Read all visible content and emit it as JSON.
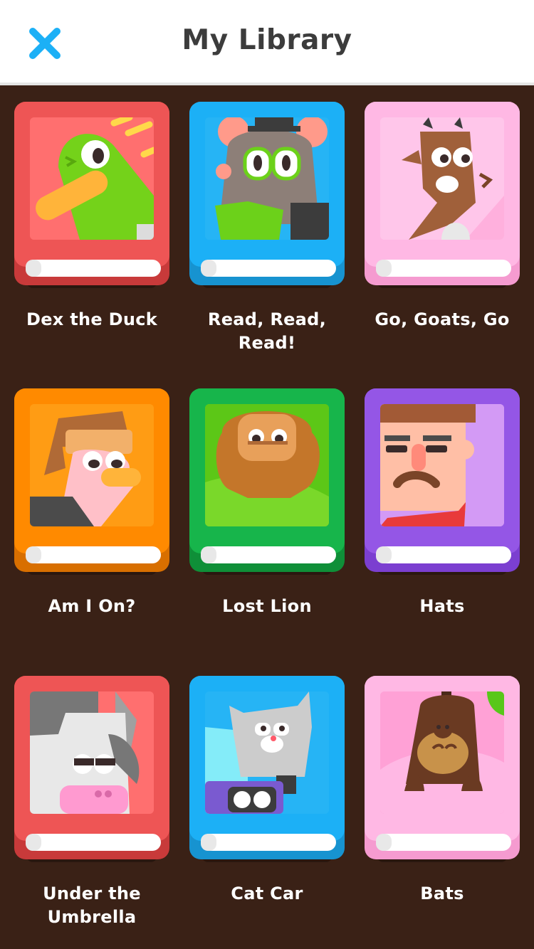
{
  "header": {
    "title": "My Library",
    "close_icon": "close-icon",
    "close_color": "#1cb0f6"
  },
  "colors": {
    "background": "#3a2116",
    "header_bg": "#ffffff"
  },
  "books": [
    {
      "title": "Dex the Duck",
      "cover_color": "#ee5555",
      "icon": "duck-illustration"
    },
    {
      "title": "Read, Read, Read!",
      "cover_color": "#1cb0f6",
      "icon": "mouse-reading-illustration"
    },
    {
      "title": "Go, Goats, Go",
      "cover_color": "#ffb4e2",
      "icon": "goat-illustration"
    },
    {
      "title": "Am I On?",
      "cover_color": "#ff8a00",
      "icon": "ostrich-illustration"
    },
    {
      "title": "Lost Lion",
      "cover_color": "#17b54b",
      "icon": "lion-illustration"
    },
    {
      "title": "Hats",
      "cover_color": "#9456e6",
      "icon": "man-with-mustache-illustration"
    },
    {
      "title": "Under the Umbrella",
      "cover_color": "#ee5555",
      "icon": "cow-illustration"
    },
    {
      "title": "Cat Car",
      "cover_color": "#1cb0f6",
      "icon": "cat-in-car-illustration"
    },
    {
      "title": "Bats",
      "cover_color": "#ffb4e2",
      "icon": "bat-illustration"
    }
  ]
}
